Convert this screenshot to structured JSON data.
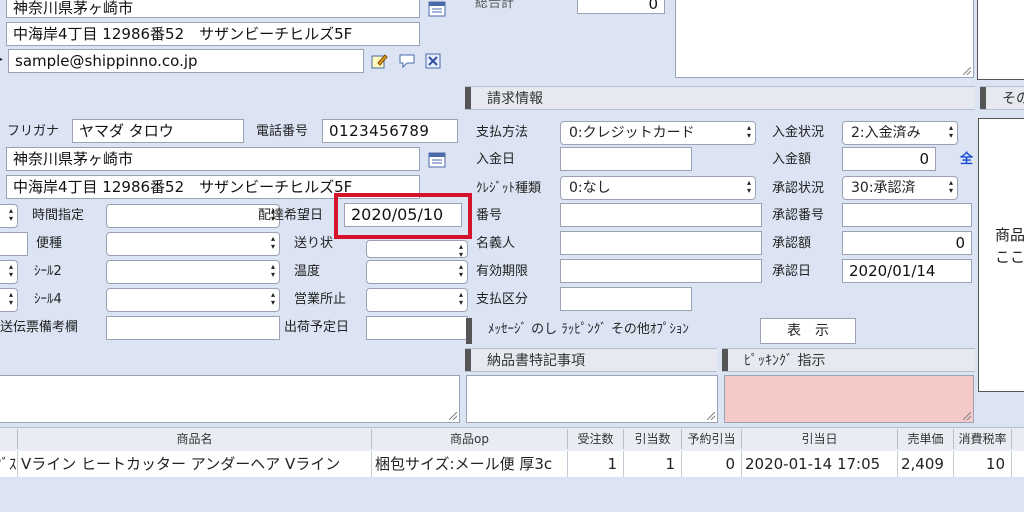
{
  "top": {
    "pref": "神奈川県茅ヶ崎市",
    "address": "中海岸4丁目 12986番52　サザンビーチヒルズ5F",
    "email": "sample@shippinno.co.jp",
    "total_label": "総合計",
    "total_value": "0"
  },
  "billing_header": "請求情報",
  "other_header": "その",
  "shipping": {
    "furigana_label": "フリガナ",
    "furigana_value": "ヤマダ タロウ",
    "phone_label": "電話番号",
    "phone_value": "0123456789",
    "pref": "神奈川県茅ヶ崎市",
    "address": "中海岸4丁目 12986番52　サザンビーチヒルズ5F",
    "time_label": "時間指定",
    "delivery_date_label": "配達希望日",
    "delivery_date_value": "2020/05/10",
    "service_label": "便種",
    "invoice_label": "送り状",
    "seal2_label": "ｼｰﾙ2",
    "temp_label": "温度",
    "seal4_label": "ｼｰﾙ4",
    "office_label": "営業所止",
    "slip_note_label": "送伝票備考欄",
    "ship_date_label": "出荷予定日"
  },
  "payment": {
    "method_label": "支払方法",
    "method_value": "0:クレジットカード",
    "deposit_date_label": "入金日",
    "card_type_label": "ｸﾚｼﾞｯﾄ種類",
    "card_type_value": "0:なし",
    "number_label": "番号",
    "holder_label": "名義人",
    "expiry_label": "有効期限",
    "pay_type_label": "支払区分"
  },
  "status": {
    "deposit_status_label": "入金状況",
    "deposit_status_value": "2:入金済み",
    "deposit_amount_label": "入金額",
    "deposit_amount_value": "0",
    "all_link": "全",
    "approval_status_label": "承認状況",
    "approval_status_value": "30:承認済",
    "approval_number_label": "承認番号",
    "approval_amount_label": "承認額",
    "approval_amount_value": "0",
    "approval_date_label": "承認日",
    "approval_date_value": "2020/01/14"
  },
  "options": {
    "label": "ﾒｯｾｰｼﾞ のし ﾗｯﾋﾟﾝｸﾞ その他ｵﾌﾟｼｮﾝ",
    "show_button": "表　示"
  },
  "notes": {
    "delivery_note_header": "納品書特記事項",
    "picking_header": "ﾋﾟｯｷﾝｸﾞ 指示",
    "right_panel_text_1": "商品",
    "right_panel_text_2": "ここ"
  },
  "table": {
    "headers": [
      "商品名",
      "商品op",
      "受注数",
      "引当数",
      "予約引当",
      "引当日",
      "売単価",
      "消費税率"
    ],
    "row": {
      "code": "ｸﾞｽ",
      "name": "Vライン ヒートカッター アンダーヘア Vライン",
      "option": "梱包サイズ:メール便 厚3c",
      "ordered": "1",
      "allocated": "1",
      "reserved": "0",
      "alloc_date": "2020-01-14 17:05",
      "price": "2,409",
      "tax": "10"
    }
  },
  "colors": {
    "highlight": "#d4122a",
    "picking_bg": "#f6c9c9",
    "link_blue": "#1a4bd6"
  }
}
